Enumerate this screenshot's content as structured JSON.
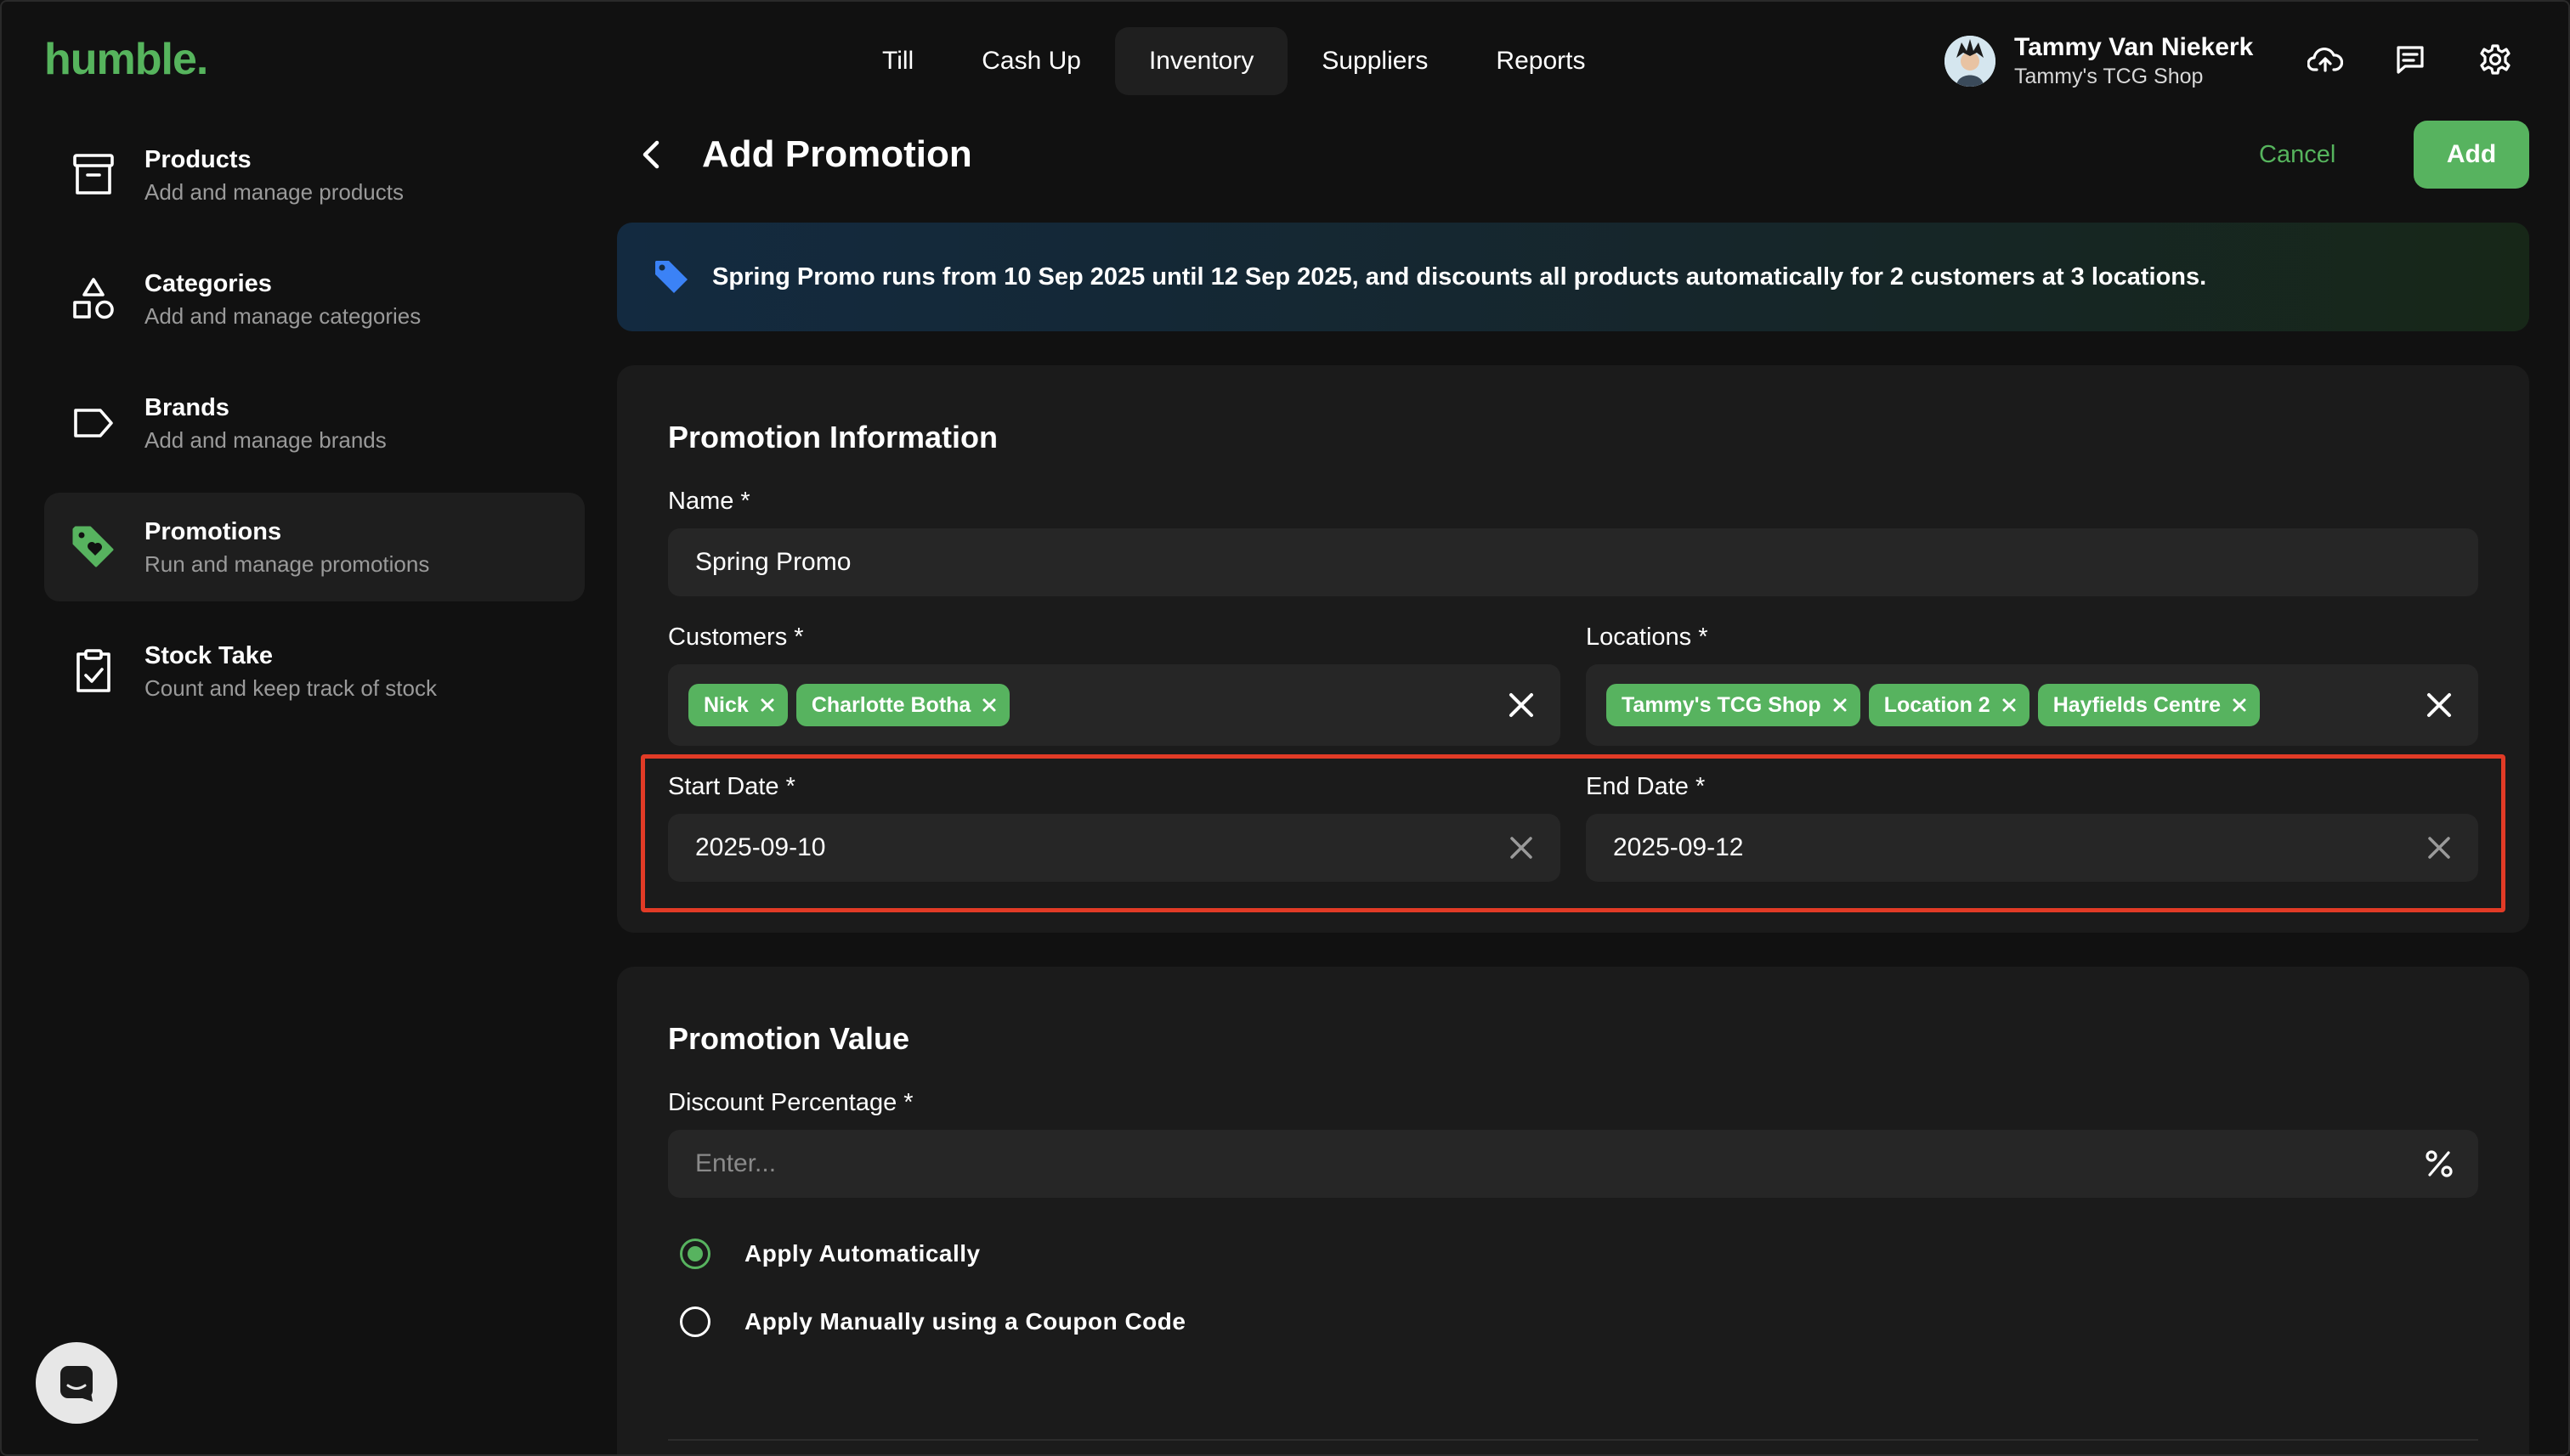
{
  "app": {
    "logo": "humble."
  },
  "topnav": {
    "items": [
      {
        "label": "Till",
        "active": false
      },
      {
        "label": "Cash Up",
        "active": false
      },
      {
        "label": "Inventory",
        "active": true
      },
      {
        "label": "Suppliers",
        "active": false
      },
      {
        "label": "Reports",
        "active": false
      }
    ]
  },
  "user": {
    "name": "Tammy Van Niekerk",
    "shop": "Tammy's TCG Shop"
  },
  "sidebar": {
    "items": [
      {
        "title": "Products",
        "subtitle": "Add and manage products",
        "icon": "archive-box-icon",
        "active": false
      },
      {
        "title": "Categories",
        "subtitle": "Add and manage categories",
        "icon": "shapes-icon",
        "active": false
      },
      {
        "title": "Brands",
        "subtitle": "Add and manage brands",
        "icon": "tag-outline-icon",
        "active": false
      },
      {
        "title": "Promotions",
        "subtitle": "Run and manage promotions",
        "icon": "tag-heart-icon",
        "active": true
      },
      {
        "title": "Stock Take",
        "subtitle": "Count and keep track of stock",
        "icon": "clipboard-check-icon",
        "active": false
      }
    ]
  },
  "header": {
    "title": "Add Promotion",
    "cancel_label": "Cancel",
    "add_label": "Add"
  },
  "banner": {
    "text": "Spring Promo runs from 10 Sep 2025 until 12 Sep 2025, and discounts all products automatically for 2 customers at 3 locations."
  },
  "promotion_info": {
    "title": "Promotion Information",
    "name_label": "Name *",
    "name_value": "Spring Promo",
    "customers_label": "Customers *",
    "customers": [
      "Nick",
      "Charlotte Botha"
    ],
    "locations_label": "Locations *",
    "locations": [
      "Tammy's TCG Shop",
      "Location 2",
      "Hayfields Centre"
    ],
    "start_label": "Start Date *",
    "start_value": "2025-09-10",
    "end_label": "End Date *",
    "end_value": "2025-09-12"
  },
  "promotion_value": {
    "title": "Promotion Value",
    "discount_label": "Discount Percentage *",
    "discount_placeholder": "Enter...",
    "options": [
      {
        "label": "Apply Automatically",
        "selected": true
      },
      {
        "label": "Apply Manually using a Coupon Code",
        "selected": false
      }
    ]
  },
  "colors": {
    "accent": "#57b35f",
    "highlight": "#e23b26",
    "background": "#111111",
    "card": "#1b1b1b"
  }
}
